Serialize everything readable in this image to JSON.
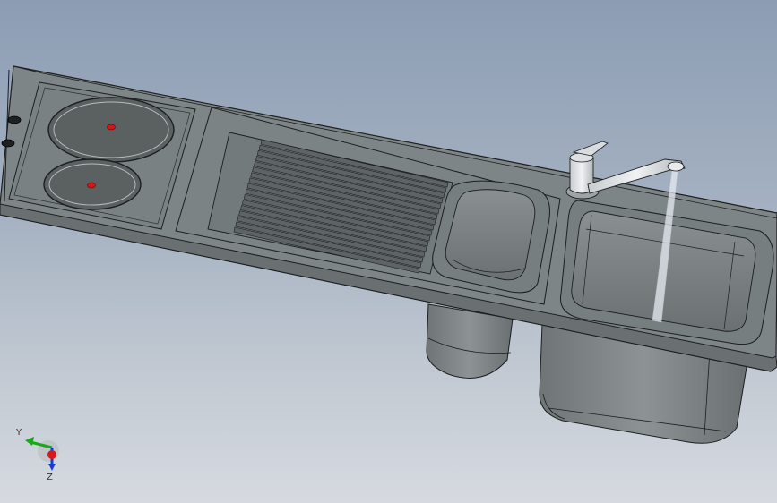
{
  "viewport": {
    "background_top": "#8c9db3",
    "background_bottom": "#d6dae0"
  },
  "model": {
    "body_color": "#7e8587",
    "edge_color": "#1c1e1f",
    "hob_burner_color": "#5b6061",
    "burner_marker_color": "#d41616",
    "water_color": "#e6ecf2"
  },
  "triad": {
    "x_label": "",
    "y_label": "Y",
    "z_label": "Z",
    "y_color": "#18a818",
    "z_color": "#1a3ad8",
    "x_color": "#d81818"
  }
}
